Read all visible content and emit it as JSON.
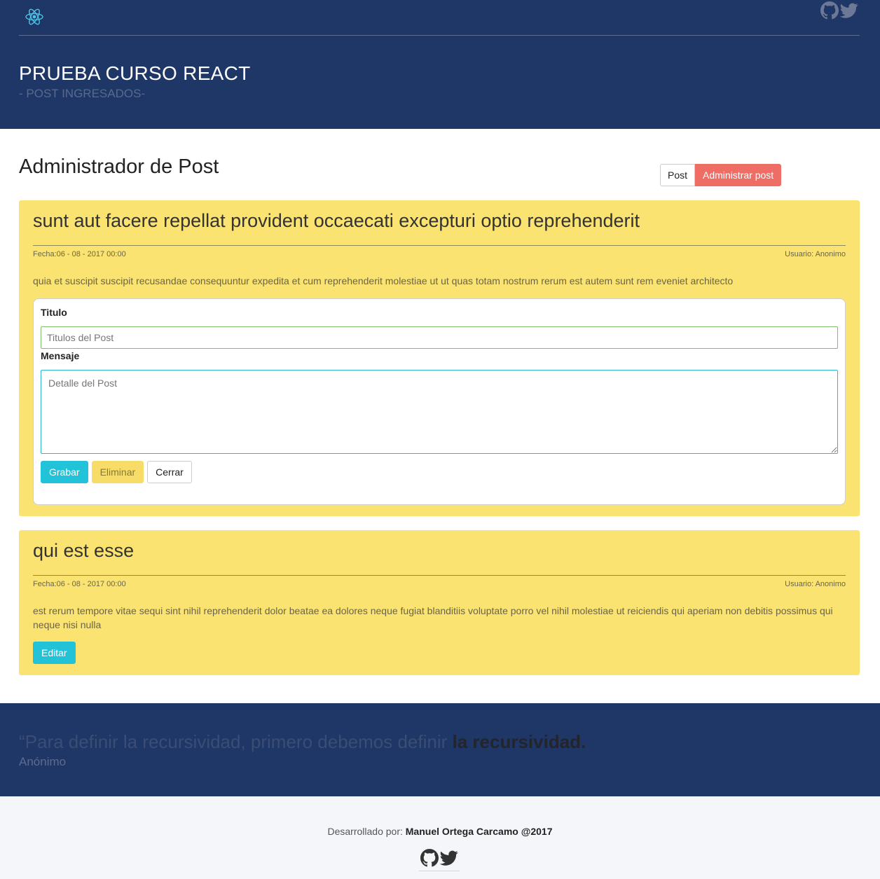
{
  "header": {
    "logo_icon": "react-atom-icon",
    "social_icons": [
      "github-icon",
      "twitter-icon"
    ],
    "title": "PRUEBA CURSO REACT",
    "subtitle": "- POST INGRESADOS-"
  },
  "main": {
    "page_title": "Administrador de Post",
    "buttons": {
      "post": "Post",
      "admin": "Administrar post"
    }
  },
  "posts": [
    {
      "title": "sunt aut facere repellat provident occaecati excepturi optio reprehenderit",
      "date": "Fecha:06 - 08 - 2017 00:00",
      "user": "Usuario: Anonimo",
      "body": "quia et suscipit suscipit recusandae consequuntur expedita et cum reprehenderit molestiae ut ut quas totam nostrum rerum est autem sunt rem eveniet architecto",
      "form": {
        "title_label": "Titulo",
        "title_placeholder": "Titulos del Post",
        "message_label": "Mensaje",
        "message_placeholder": "Detalle del Post",
        "save": "Grabar",
        "delete": "Eliminar",
        "close": "Cerrar"
      }
    },
    {
      "title": "qui est esse",
      "date": "Fecha:06 - 08 - 2017 00:00",
      "user": "Usuario: Anonimo",
      "body": "est rerum tempore vitae sequi sint nihil reprehenderit dolor beatae ea dolores neque fugiat blanditiis voluptate porro vel nihil molestiae ut reiciendis qui aperiam non debitis possimus qui neque nisi nulla",
      "edit": "Editar"
    }
  ],
  "quote": {
    "text": "“Para definir la recursividad, primero debemos definir ",
    "emphasis": "la recursividad.",
    "author": "Anónimo"
  },
  "footer": {
    "prefix": "Desarrollado por: ",
    "author": "Manuel Ortega Carcamo @2017",
    "social_icons": [
      "github-icon",
      "twitter-icon"
    ]
  },
  "colors": {
    "header_bg": "#1e3766",
    "card_bg": "#fae370",
    "accent_info": "#22c3d9",
    "accent_danger": "#ee6e66",
    "footer_bg": "#f5f6f9"
  }
}
